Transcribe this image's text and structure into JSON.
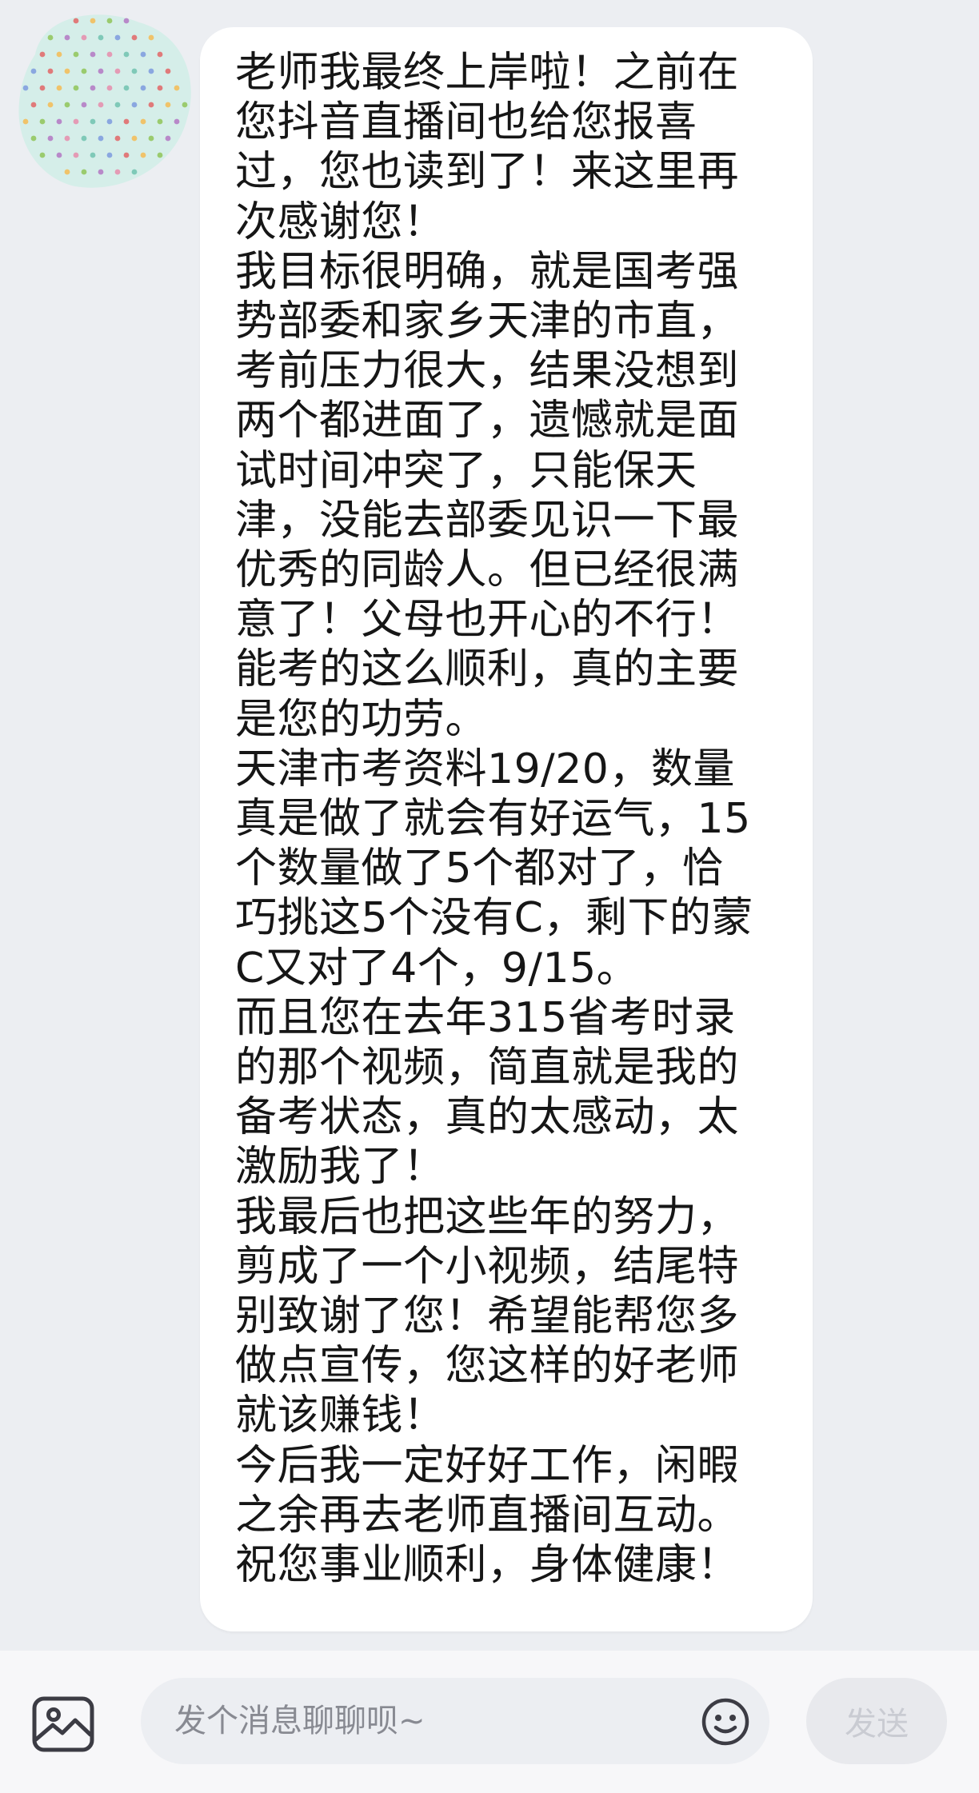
{
  "message": {
    "lines": [
      "老师我最终上岸啦！之前在",
      "您抖音直播间也给您报喜",
      "过，您也读到了！来这里再",
      "次感谢您！",
      "我目标很明确，就是国考强",
      "势部委和家乡天津的市直，",
      "考前压力很大，结果没想到",
      "两个都进面了，遗憾就是面",
      "试时间冲突了，只能保天",
      "津，没能去部委见识一下最",
      "优秀的同龄人。但已经很满",
      "意了！父母也开心的不行！",
      "能考的这么顺利，真的主要",
      "是您的功劳。",
      "天津市考资料19/20，数量",
      "真是做了就会有好运气，15",
      "个数量做了5个都对了，恰",
      "巧挑这5个没有C，剩下的蒙",
      "C又对了4个，9/15。",
      "而且您在去年315省考时录",
      "的那个视频，简直就是我的",
      "备考状态，真的太感动，太",
      "激励我了！",
      "我最后也把这些年的努力，",
      "剪成了一个小视频，结尾特",
      "别致谢了您！希望能帮您多",
      "做点宣传，您这样的好老师",
      "就该赚钱！",
      "今后我一定好好工作，闲暇",
      "之余再去老师直播间互动。",
      "祝您事业顺利，身体健康！"
    ]
  },
  "input_bar": {
    "placeholder": "发个消息聊聊呗~",
    "send_label": "发送",
    "image_icon": "image-icon",
    "emoji_icon": "emoji-icon"
  },
  "colors": {
    "chat_background": "#eceef2",
    "bubble_background": "#ffffff",
    "input_bar_background": "#f7f7f9",
    "send_text": "#c9cbd2"
  }
}
